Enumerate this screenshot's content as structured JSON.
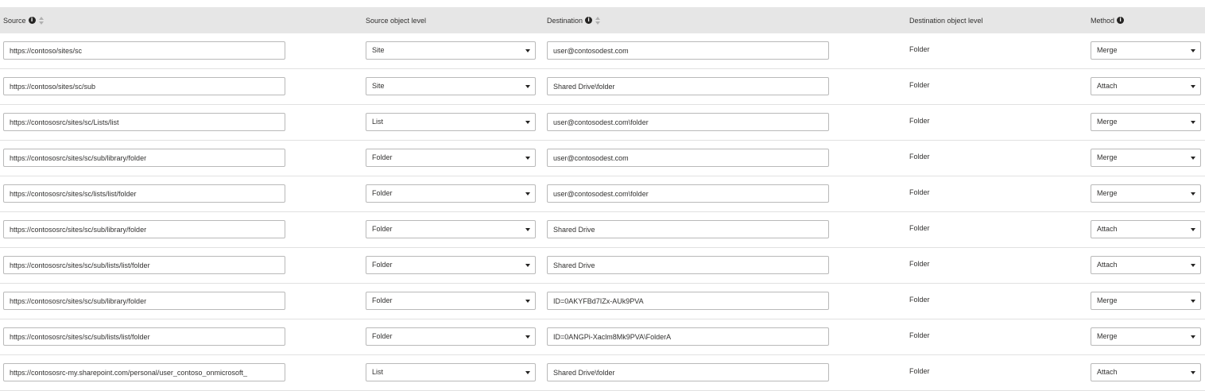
{
  "columns": {
    "source": "Source",
    "source_level": "Source object level",
    "destination": "Destination",
    "destination_level": "Destination object level",
    "method": "Method"
  },
  "info_glyph": "i",
  "rows": [
    {
      "source": "https://contoso/sites/sc",
      "source_level": "Site",
      "destination": "user@contosodest.com",
      "destination_level": "Folder",
      "method": "Merge"
    },
    {
      "source": "https://contoso/sites/sc/sub",
      "source_level": "Site",
      "destination": "Shared Drive\\folder",
      "destination_level": "Folder",
      "method": "Attach"
    },
    {
      "source": "https://contososrc/sites/sc/Lists/list",
      "source_level": "List",
      "destination": "user@contosodest.com\\folder",
      "destination_level": "Folder",
      "method": "Merge"
    },
    {
      "source": "https://contososrc/sites/sc/sub/library/folder",
      "source_level": "Folder",
      "destination": "user@contosodest.com",
      "destination_level": "Folder",
      "method": "Merge"
    },
    {
      "source": "https://contososrc/sites/sc/lists/list/folder",
      "source_level": "Folder",
      "destination": "user@contosodest.com\\folder",
      "destination_level": "Folder",
      "method": "Merge"
    },
    {
      "source": "https://contososrc/sites/sc/sub/library/folder",
      "source_level": "Folder",
      "destination": "Shared Drive",
      "destination_level": "Folder",
      "method": "Attach"
    },
    {
      "source": "https://contososrc/sites/sc/sub/lists/list/folder",
      "source_level": "Folder",
      "destination": "Shared Drive",
      "destination_level": "Folder",
      "method": "Attach"
    },
    {
      "source": "https://contososrc/sites/sc/sub/library/folder",
      "source_level": "Folder",
      "destination": "ID=0AKYFBd7IZx-AUk9PVA",
      "destination_level": "Folder",
      "method": "Merge"
    },
    {
      "source": "https://contososrc/sites/sc/sub/lists/list/folder",
      "source_level": "Folder",
      "destination": "ID=0ANGPi-Xaclm8Mk9PVA\\FolderA",
      "destination_level": "Folder",
      "method": "Merge"
    },
    {
      "source": "https://contososrc-my.sharepoint.com/personal/user_contoso_onmicrosoft_",
      "source_level": "List",
      "destination": "Shared Drive\\folder",
      "destination_level": "Folder",
      "method": "Attach"
    }
  ]
}
